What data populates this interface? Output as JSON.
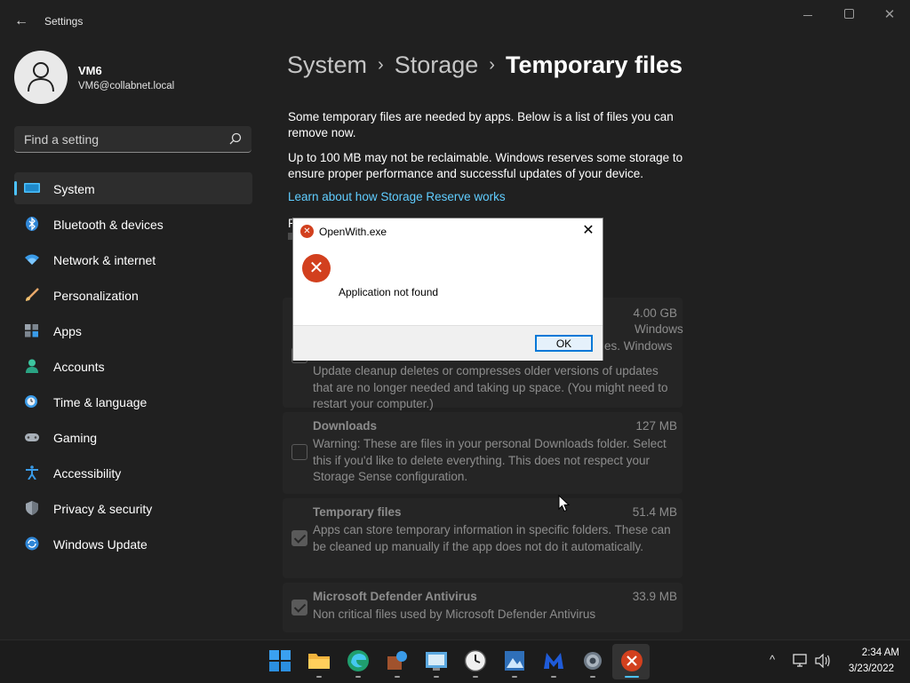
{
  "window": {
    "title": "Settings",
    "back_glyph": "←",
    "close_glyph": "✕"
  },
  "user": {
    "name": "VM6",
    "email": "VM6@collabnet.local"
  },
  "search": {
    "placeholder": "Find a setting",
    "value": ""
  },
  "nav": {
    "items": [
      {
        "label": "System",
        "icon": "system-icon",
        "active": true
      },
      {
        "label": "Bluetooth & devices",
        "icon": "bluetooth-icon"
      },
      {
        "label": "Network & internet",
        "icon": "wifi-icon"
      },
      {
        "label": "Personalization",
        "icon": "brush-icon"
      },
      {
        "label": "Apps",
        "icon": "apps-icon"
      },
      {
        "label": "Accounts",
        "icon": "account-icon"
      },
      {
        "label": "Time & language",
        "icon": "clock-globe-icon"
      },
      {
        "label": "Gaming",
        "icon": "gamepad-icon"
      },
      {
        "label": "Accessibility",
        "icon": "accessibility-icon"
      },
      {
        "label": "Privacy & security",
        "icon": "shield-icon"
      },
      {
        "label": "Windows Update",
        "icon": "update-icon"
      }
    ]
  },
  "breadcrumb": {
    "part1": "System",
    "part2": "Storage",
    "current": "Temporary files",
    "separator": "›"
  },
  "main": {
    "para1": "Some temporary files are needed by apps. Below is a list of files you can remove now.",
    "para2": "Up to 100 MB may not be reclaimable. Windows reserves some storage to ensure proper performance and successful updates of your device.",
    "learn_link": "Learn about how Storage Reserve works",
    "partial_text": "R"
  },
  "cards": [
    {
      "title": "",
      "size": "4.00 GB",
      "checked": false,
      "desc": "Windows update cleanup deletes or compresses older versions of updates that are no longer needed and taking up space. (You might need to restart your computer.)",
      "desc_visible_fragment_1": "Windows",
      "desc_visible_fragment_2": "es. Windows"
    },
    {
      "title": "Downloads",
      "size": "127 MB",
      "checked": false,
      "desc": "Warning: These are files in your personal Downloads folder. Select this if you'd like to delete everything. This does not respect your Storage Sense configuration."
    },
    {
      "title": "Temporary files",
      "size": "51.4 MB",
      "checked": true,
      "desc": "Apps can store temporary information in specific folders. These can be cleaned up manually if the app does not do it automatically."
    },
    {
      "title": "Microsoft Defender Antivirus",
      "size": "33.9 MB",
      "checked": true,
      "desc": "Non critical files used by Microsoft Defender Antivirus"
    }
  ],
  "dialog": {
    "title": "OpenWith.exe",
    "message": "Application not found",
    "ok_label": "OK",
    "error_glyph": "✕",
    "close_glyph": "✕"
  },
  "taskbar": {
    "apps": [
      "start-icon",
      "file-explorer-icon",
      "edge-icon",
      "app-icon",
      "control-panel-icon",
      "clock-app-icon",
      "photo-viewer-icon",
      "malwarebytes-icon",
      "settings-icon",
      "error-app-icon"
    ],
    "tray_chevron": "^",
    "time": "2:34 AM",
    "date": "3/23/2022"
  },
  "colors": {
    "accent": "#4cc2ff",
    "link": "#60cdff",
    "error": "#d2401e",
    "background": "#202020"
  }
}
